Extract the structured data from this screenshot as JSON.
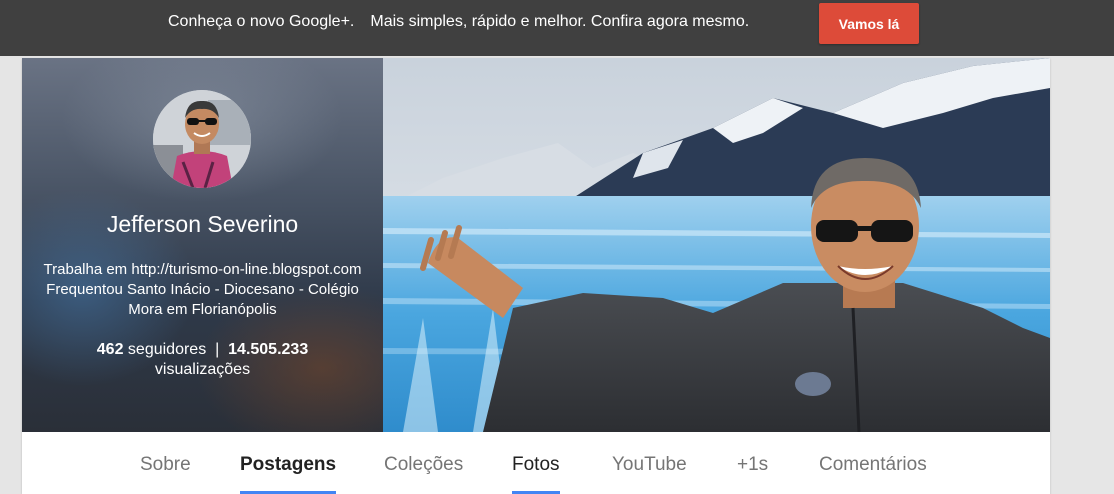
{
  "promo": {
    "message_part1": "Conheça o novo Google+.",
    "message_part2": "Mais simples, rápido e melhor. Confira agora mesmo.",
    "cta_label": "Vamos lá"
  },
  "profile": {
    "name": "Jefferson Severino",
    "info": [
      "Trabalha em http://turismo-on-line.blogspot.com",
      "Frequentou Santo Inácio - Diocesano - Colégio",
      "Mora em Florianópolis"
    ],
    "followers_count": "462",
    "followers_label": "seguidores",
    "separator": "|",
    "views_count": "14.505.233",
    "views_label": "visualizações"
  },
  "tabs": [
    {
      "label": "Sobre",
      "active": false
    },
    {
      "label": "Postagens",
      "active": true
    },
    {
      "label": "Coleções",
      "active": false
    },
    {
      "label": "Fotos",
      "active": true
    },
    {
      "label": "YouTube",
      "active": false
    },
    {
      "label": "+1s",
      "active": false
    },
    {
      "label": "Comentários",
      "active": false
    }
  ],
  "colors": {
    "banner_bg": "#404040",
    "cta_red": "#dd4b39",
    "tab_underline": "#4285f4"
  }
}
